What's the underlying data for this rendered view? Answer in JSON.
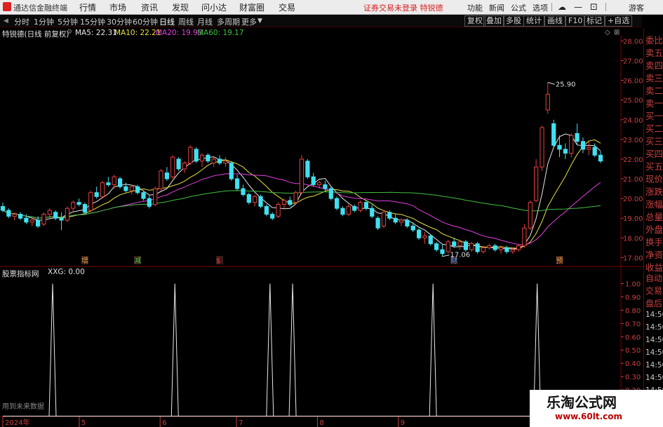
{
  "topbar": {
    "app_name": "通达信金融终端",
    "menu": [
      "行情",
      "市场",
      "资讯",
      "发现",
      "问小达",
      "财富圈",
      "交易"
    ],
    "notice": "证券交易未登录",
    "notice_stock": "特锐德",
    "tools": [
      "功能",
      "新闻",
      "公式",
      "选项"
    ],
    "guest": "游客"
  },
  "periods": [
    "分时",
    "1分钟",
    "5分钟",
    "15分钟",
    "30分钟",
    "60分钟",
    "日线",
    "周线",
    "月线",
    "多周期",
    "更多"
  ],
  "active_period": "日线",
  "period_buttons": [
    "复权",
    "叠加",
    "多股",
    "统计",
    "画线",
    "F10",
    "标记",
    "+自选"
  ],
  "stock_info": {
    "name_label": "特锐德(日线 前复权)",
    "ma5": "MA5: 22.31",
    "ma10": "MA10: 22.21",
    "ma20": "MA20: 19.93",
    "ma60": "MA60: 19.17"
  },
  "indicator_info": {
    "name": "股票指标网",
    "value": "XXG: 0.00"
  },
  "bottom_note": "用到未来数据",
  "right_panel": {
    "labels_top": [
      "委比",
      "卖五",
      "卖四",
      "卖三",
      "卖二",
      "卖一",
      "买一",
      "买二",
      "买三",
      "买四",
      "买五",
      "现价",
      "涨跌",
      "涨幅",
      "总量",
      "外盘",
      "换手",
      "净资",
      "收益"
    ],
    "labels_bottom": [
      "自动",
      "交易",
      "盘后"
    ],
    "times": [
      "14:50",
      "14:50",
      "14:50",
      "14:50",
      "14:50",
      "14:50",
      "14:50"
    ]
  },
  "colors": {
    "up": "#e84040",
    "down": "#40e0f0",
    "ma5": "#e8e8e8",
    "ma10": "#e8e040",
    "ma20": "#e040e0",
    "ma60": "#40c040",
    "axis": "#c84040"
  },
  "chart_data": [
    {
      "type": "candlestick",
      "title": "特锐德(日线 前复权)",
      "ylim": [
        16.8,
        28.3
      ],
      "yticks": [
        17.0,
        18.0,
        19.0,
        20.0,
        21.0,
        22.0,
        23.0,
        24.0,
        25.0,
        26.0,
        27.0,
        28.0
      ],
      "x_labels": [
        "2024年",
        "5",
        "6",
        "7",
        "8",
        "9"
      ],
      "annotations": [
        {
          "text": "25.90",
          "kind": "high"
        },
        {
          "text": "17.06",
          "kind": "low"
        }
      ],
      "markers": [
        "增",
        "减",
        "$",
        "财",
        "预"
      ],
      "candles": [
        {
          "o": 19.6,
          "h": 19.8,
          "l": 19.3,
          "c": 19.4
        },
        {
          "o": 19.4,
          "h": 19.5,
          "l": 19.0,
          "c": 19.1
        },
        {
          "o": 19.1,
          "h": 19.3,
          "l": 18.9,
          "c": 19.2
        },
        {
          "o": 19.2,
          "h": 19.3,
          "l": 18.9,
          "c": 19.0
        },
        {
          "o": 19.0,
          "h": 19.2,
          "l": 18.7,
          "c": 18.8
        },
        {
          "o": 18.8,
          "h": 19.0,
          "l": 18.6,
          "c": 18.9
        },
        {
          "o": 18.9,
          "h": 19.1,
          "l": 18.5,
          "c": 18.6
        },
        {
          "o": 18.7,
          "h": 19.3,
          "l": 18.6,
          "c": 19.2
        },
        {
          "o": 19.2,
          "h": 19.5,
          "l": 19.0,
          "c": 19.4
        },
        {
          "o": 19.3,
          "h": 19.4,
          "l": 18.9,
          "c": 19.0
        },
        {
          "o": 19.0,
          "h": 19.3,
          "l": 18.4,
          "c": 18.9
        },
        {
          "o": 18.9,
          "h": 19.6,
          "l": 18.8,
          "c": 19.5
        },
        {
          "o": 19.5,
          "h": 19.9,
          "l": 19.3,
          "c": 19.8
        },
        {
          "o": 19.8,
          "h": 20.0,
          "l": 19.6,
          "c": 19.7
        },
        {
          "o": 19.7,
          "h": 19.8,
          "l": 19.2,
          "c": 19.3
        },
        {
          "o": 19.4,
          "h": 20.4,
          "l": 19.3,
          "c": 20.3
        },
        {
          "o": 20.3,
          "h": 20.6,
          "l": 20.0,
          "c": 20.1
        },
        {
          "o": 20.1,
          "h": 20.9,
          "l": 20.0,
          "c": 20.8
        },
        {
          "o": 20.8,
          "h": 21.1,
          "l": 20.6,
          "c": 20.7
        },
        {
          "o": 20.7,
          "h": 21.2,
          "l": 20.5,
          "c": 21.1
        },
        {
          "o": 21.0,
          "h": 21.1,
          "l": 20.5,
          "c": 20.6
        },
        {
          "o": 20.6,
          "h": 20.8,
          "l": 20.3,
          "c": 20.4
        },
        {
          "o": 20.4,
          "h": 20.7,
          "l": 20.2,
          "c": 20.6
        },
        {
          "o": 20.6,
          "h": 20.7,
          "l": 20.2,
          "c": 20.3
        },
        {
          "o": 20.3,
          "h": 20.4,
          "l": 19.9,
          "c": 20.0
        },
        {
          "o": 20.0,
          "h": 20.2,
          "l": 19.5,
          "c": 19.6
        },
        {
          "o": 19.7,
          "h": 20.6,
          "l": 19.6,
          "c": 20.5
        },
        {
          "o": 20.5,
          "h": 21.5,
          "l": 20.4,
          "c": 21.4
        },
        {
          "o": 21.3,
          "h": 21.6,
          "l": 20.9,
          "c": 21.0
        },
        {
          "o": 21.1,
          "h": 22.2,
          "l": 21.0,
          "c": 22.1
        },
        {
          "o": 22.0,
          "h": 22.1,
          "l": 21.4,
          "c": 21.5
        },
        {
          "o": 21.5,
          "h": 21.9,
          "l": 21.3,
          "c": 21.8
        },
        {
          "o": 21.8,
          "h": 22.7,
          "l": 21.7,
          "c": 22.6
        },
        {
          "o": 22.5,
          "h": 22.6,
          "l": 21.8,
          "c": 21.9
        },
        {
          "o": 21.9,
          "h": 22.3,
          "l": 21.6,
          "c": 22.2
        },
        {
          "o": 22.2,
          "h": 22.3,
          "l": 21.8,
          "c": 21.9
        },
        {
          "o": 21.8,
          "h": 22.1,
          "l": 21.6,
          "c": 22.0
        },
        {
          "o": 22.0,
          "h": 22.2,
          "l": 21.7,
          "c": 21.8
        },
        {
          "o": 21.8,
          "h": 22.1,
          "l": 21.6,
          "c": 21.9
        },
        {
          "o": 21.8,
          "h": 21.9,
          "l": 20.9,
          "c": 21.0
        },
        {
          "o": 21.0,
          "h": 21.2,
          "l": 20.4,
          "c": 20.5
        },
        {
          "o": 20.5,
          "h": 20.7,
          "l": 20.1,
          "c": 20.2
        },
        {
          "o": 20.2,
          "h": 20.3,
          "l": 19.7,
          "c": 19.8
        },
        {
          "o": 19.8,
          "h": 20.2,
          "l": 19.6,
          "c": 20.1
        },
        {
          "o": 20.1,
          "h": 20.2,
          "l": 19.5,
          "c": 19.6
        },
        {
          "o": 19.6,
          "h": 19.7,
          "l": 19.1,
          "c": 19.2
        },
        {
          "o": 19.2,
          "h": 19.3,
          "l": 18.9,
          "c": 19.0
        },
        {
          "o": 19.1,
          "h": 19.8,
          "l": 19.0,
          "c": 19.7
        },
        {
          "o": 19.7,
          "h": 20.0,
          "l": 19.5,
          "c": 19.9
        },
        {
          "o": 19.9,
          "h": 20.1,
          "l": 19.6,
          "c": 19.7
        },
        {
          "o": 19.8,
          "h": 20.4,
          "l": 19.7,
          "c": 20.3
        },
        {
          "o": 20.3,
          "h": 22.2,
          "l": 20.2,
          "c": 22.0
        },
        {
          "o": 21.9,
          "h": 22.0,
          "l": 21.0,
          "c": 21.1
        },
        {
          "o": 21.1,
          "h": 21.3,
          "l": 20.6,
          "c": 20.7
        },
        {
          "o": 20.7,
          "h": 20.9,
          "l": 20.5,
          "c": 20.8
        },
        {
          "o": 20.7,
          "h": 20.9,
          "l": 20.4,
          "c": 20.5
        },
        {
          "o": 20.5,
          "h": 20.6,
          "l": 19.9,
          "c": 20.0
        },
        {
          "o": 20.0,
          "h": 20.1,
          "l": 19.4,
          "c": 19.5
        },
        {
          "o": 19.5,
          "h": 19.6,
          "l": 19.1,
          "c": 19.2
        },
        {
          "o": 19.2,
          "h": 19.7,
          "l": 19.1,
          "c": 19.6
        },
        {
          "o": 19.6,
          "h": 19.7,
          "l": 19.3,
          "c": 19.4
        },
        {
          "o": 19.4,
          "h": 19.9,
          "l": 19.3,
          "c": 19.8
        },
        {
          "o": 19.8,
          "h": 19.9,
          "l": 19.4,
          "c": 19.5
        },
        {
          "o": 19.5,
          "h": 19.7,
          "l": 19.0,
          "c": 19.1
        },
        {
          "o": 19.0,
          "h": 19.1,
          "l": 18.4,
          "c": 18.5
        },
        {
          "o": 18.6,
          "h": 19.4,
          "l": 18.5,
          "c": 19.3
        },
        {
          "o": 19.3,
          "h": 19.4,
          "l": 18.9,
          "c": 19.0
        },
        {
          "o": 19.0,
          "h": 19.2,
          "l": 18.7,
          "c": 18.8
        },
        {
          "o": 18.8,
          "h": 19.0,
          "l": 18.6,
          "c": 18.9
        },
        {
          "o": 18.9,
          "h": 19.0,
          "l": 18.5,
          "c": 18.6
        },
        {
          "o": 18.6,
          "h": 18.8,
          "l": 18.3,
          "c": 18.4
        },
        {
          "o": 18.4,
          "h": 18.5,
          "l": 17.9,
          "c": 18.0
        },
        {
          "o": 18.0,
          "h": 18.3,
          "l": 17.7,
          "c": 18.1
        },
        {
          "o": 18.1,
          "h": 18.2,
          "l": 17.6,
          "c": 17.7
        },
        {
          "o": 17.7,
          "h": 17.8,
          "l": 17.3,
          "c": 17.4
        },
        {
          "o": 17.4,
          "h": 17.7,
          "l": 17.06,
          "c": 17.2
        },
        {
          "o": 17.3,
          "h": 17.9,
          "l": 17.2,
          "c": 17.8
        },
        {
          "o": 17.8,
          "h": 18.0,
          "l": 17.5,
          "c": 17.6
        },
        {
          "o": 17.6,
          "h": 17.9,
          "l": 17.4,
          "c": 17.8
        },
        {
          "o": 17.8,
          "h": 17.9,
          "l": 17.3,
          "c": 17.4
        },
        {
          "o": 17.4,
          "h": 17.8,
          "l": 17.3,
          "c": 17.7
        },
        {
          "o": 17.7,
          "h": 17.8,
          "l": 17.2,
          "c": 17.3
        },
        {
          "o": 17.3,
          "h": 17.6,
          "l": 17.2,
          "c": 17.5
        },
        {
          "o": 17.5,
          "h": 17.7,
          "l": 17.4,
          "c": 17.6
        },
        {
          "o": 17.6,
          "h": 17.7,
          "l": 17.3,
          "c": 17.4
        },
        {
          "o": 17.4,
          "h": 17.6,
          "l": 17.2,
          "c": 17.5
        },
        {
          "o": 17.5,
          "h": 17.6,
          "l": 17.2,
          "c": 17.3
        },
        {
          "o": 17.3,
          "h": 17.5,
          "l": 17.2,
          "c": 17.4
        },
        {
          "o": 17.4,
          "h": 17.7,
          "l": 17.3,
          "c": 17.6
        },
        {
          "o": 17.6,
          "h": 18.7,
          "l": 17.5,
          "c": 18.5
        },
        {
          "o": 18.5,
          "h": 19.9,
          "l": 18.4,
          "c": 19.8
        },
        {
          "o": 19.9,
          "h": 22.0,
          "l": 19.8,
          "c": 21.6
        },
        {
          "o": 21.6,
          "h": 23.7,
          "l": 21.4,
          "c": 23.6
        },
        {
          "o": 24.5,
          "h": 25.9,
          "l": 24.3,
          "c": 25.3
        },
        {
          "o": 23.8,
          "h": 24.0,
          "l": 22.6,
          "c": 22.7
        },
        {
          "o": 22.7,
          "h": 23.2,
          "l": 22.1,
          "c": 22.5
        },
        {
          "o": 22.5,
          "h": 22.8,
          "l": 22.0,
          "c": 22.3
        },
        {
          "o": 22.3,
          "h": 23.3,
          "l": 22.1,
          "c": 23.2
        },
        {
          "o": 23.3,
          "h": 23.8,
          "l": 22.7,
          "c": 22.9
        },
        {
          "o": 22.9,
          "h": 23.1,
          "l": 22.3,
          "c": 22.5
        },
        {
          "o": 22.5,
          "h": 22.9,
          "l": 22.2,
          "c": 22.6
        },
        {
          "o": 22.6,
          "h": 22.8,
          "l": 22.1,
          "c": 22.2
        },
        {
          "o": 22.2,
          "h": 22.4,
          "l": 21.8,
          "c": 21.9
        }
      ]
    },
    {
      "type": "line",
      "title": "股票指标网",
      "series": [
        {
          "name": "XXG"
        }
      ],
      "ylim": [
        0,
        1.05
      ],
      "yticks": [
        0.1,
        0.2,
        0.3,
        0.4,
        0.5,
        0.6,
        0.7,
        0.8,
        0.9,
        1.0
      ],
      "signal_indices": [
        11,
        38,
        59,
        64,
        95,
        118
      ],
      "n": 133
    }
  ]
}
